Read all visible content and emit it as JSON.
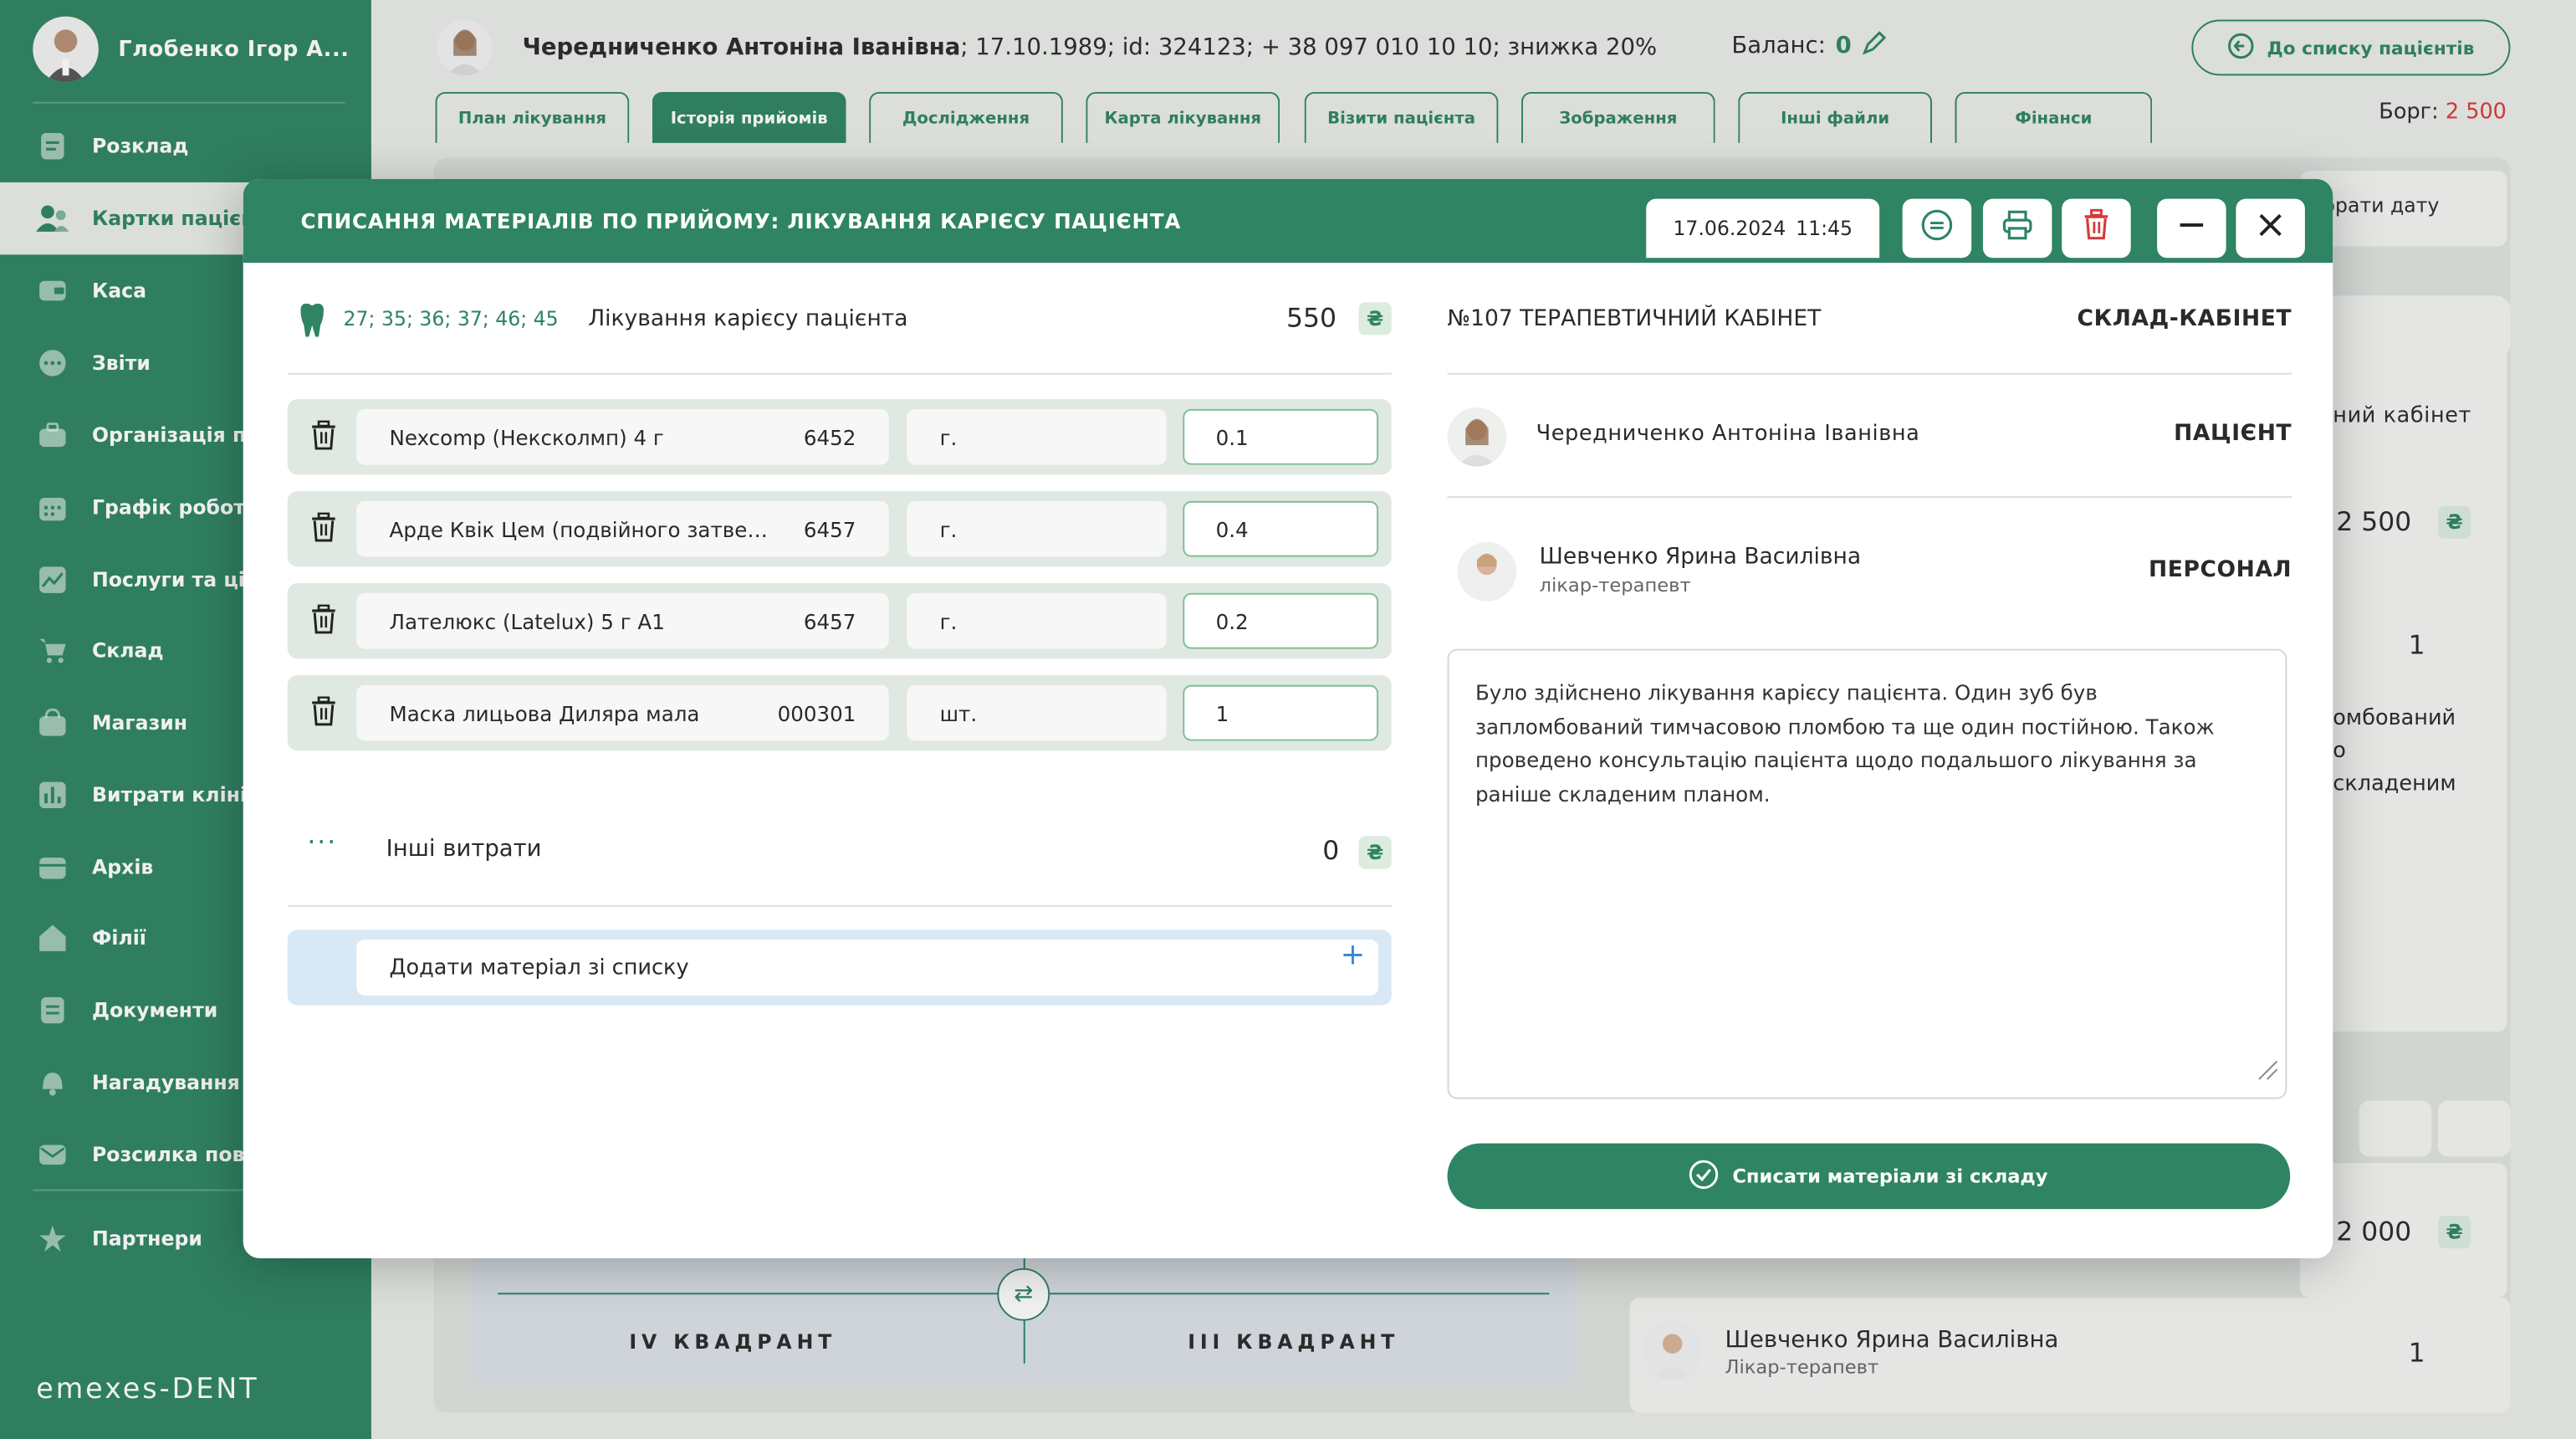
{
  "sidebar": {
    "user_name": "Глобенко Ігор А...",
    "items": [
      {
        "label": "Розклад",
        "icon": "calendar-list-icon"
      },
      {
        "label": "Картки пацієнтів",
        "icon": "patients-icon"
      },
      {
        "label": "Каса",
        "icon": "cash-icon"
      },
      {
        "label": "Звіти",
        "icon": "reports-icon"
      },
      {
        "label": "Організація прийому",
        "icon": "briefcase-icon"
      },
      {
        "label": "Графік роботи",
        "icon": "schedule-icon"
      },
      {
        "label": "Послуги та ціни",
        "icon": "chart-icon"
      },
      {
        "label": "Склад",
        "icon": "cart-icon"
      },
      {
        "label": "Магазин",
        "icon": "shop-icon"
      },
      {
        "label": "Витрати клініки",
        "icon": "expenses-icon"
      },
      {
        "label": "Архів",
        "icon": "archive-icon"
      },
      {
        "label": "Філії",
        "icon": "home-icon"
      },
      {
        "label": "Документи",
        "icon": "documents-icon"
      },
      {
        "label": "Нагадування",
        "icon": "bell-icon"
      },
      {
        "label": "Розсилка повідомлень",
        "icon": "mail-icon"
      },
      {
        "label": "Партнери",
        "icon": "star-icon"
      }
    ],
    "logo": "emexes-DENT"
  },
  "header": {
    "patient_name": "Чередниченко Антоніна Іванівна",
    "patient_details": "; 17.10.1989; id: 324123; + 38 097 010 10 10; знижка 20%",
    "balance_label": "Баланс:",
    "balance_value": "0",
    "back_button": "До списку пацієнтів",
    "debt_label": "Борг:",
    "debt_value": "2 500",
    "tabs": [
      "План лікування",
      "Історія прийомів",
      "Дослідження",
      "Карта лікування",
      "Візити пацієнта",
      "Зображення",
      "Інші файли",
      "Фінанси"
    ]
  },
  "background": {
    "pick_date": "брати дату",
    "cabinet": "ний кабінет",
    "amount1": "2 500",
    "amount2": "2 000",
    "count": "1",
    "text1": "омбований",
    "text2": "о",
    "text3": "складеним",
    "quadrant4": "IV КВАДРАНТ",
    "quadrant3": "III КВАДРАНТ",
    "doctor_name": "Шевченко Ярина Василівна",
    "doctor_role": "Лікар-терапевт"
  },
  "modal": {
    "title": "СПИСАННЯ МАТЕРІАЛІВ ПО ПРИЙОМУ: ЛІКУВАННЯ КАРІЄСУ ПАЦІЄНТА",
    "date": "17.06.2024",
    "time": "11:45",
    "service": {
      "teeth": "27; 35; 36; 37; 46; 45",
      "name": "Лікування карієсу пацієнта",
      "price": "550",
      "currency": "₴"
    },
    "materials": [
      {
        "name": "Nexcomp (Нексколмп) 4 г",
        "code": "6452",
        "unit": "г.",
        "qty": "0.1"
      },
      {
        "name": "Арде Квік Цем (подвійного затвердіння)",
        "code": "6457",
        "unit": "г.",
        "qty": "0.4"
      },
      {
        "name": "Лателюкс (Latelux) 5 г A1",
        "code": "6457",
        "unit": "г.",
        "qty": "0.2"
      },
      {
        "name": "Маска лицьова Диляра мала",
        "code": "000301",
        "unit": "шт.",
        "qty": "1"
      }
    ],
    "other_label": "Інші витрати",
    "other_value": "0",
    "add_placeholder": "Додати матеріал зі списку",
    "right": {
      "cabinet": "№107 ТЕРАПЕВТИЧНИЙ КАБІНЕТ",
      "cabinet_label": "СКЛАД-КАБІНЕТ",
      "patient": "Чередниченко Антоніна Іванівна",
      "patient_label": "ПАЦІЄНТ",
      "staff_name": "Шевченко Ярина Василівна",
      "staff_role": "лікар-терапевт",
      "staff_label": "ПЕРСОНАЛ",
      "note": "Було здійснено лікування карієсу пацієнта. Один зуб був запломбований тимчасовою пломбою та ще один постійною. Також проведено консультацію пацієнта щодо подальшого лікування за раніше складеним планом.",
      "submit": "Списати матеріали зі складу"
    }
  },
  "colors": {
    "primary": "#2e8463",
    "danger": "#d9383a",
    "accent_blue": "#3b88d1"
  }
}
